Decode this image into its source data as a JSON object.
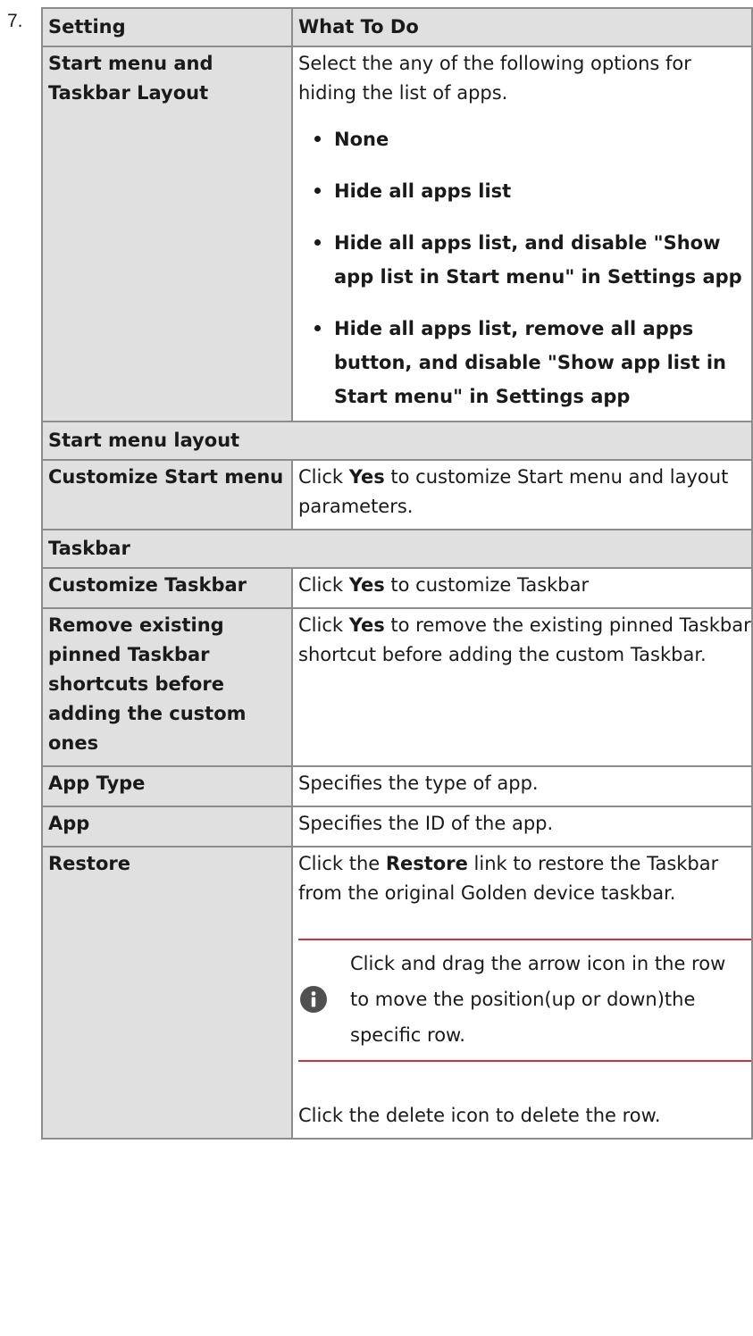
{
  "step_number": "7.",
  "table": {
    "header": {
      "setting": "Setting",
      "todo": "What To Do"
    },
    "rows": [
      {
        "setting": "Start menu and Taskbar Layout",
        "todo_intro": "Select the any of the following options for hiding the list of apps.",
        "options": [
          "None",
          "Hide all apps list",
          "Hide all apps list, and disable \"Show app list in Start menu\" in Settings app",
          "Hide all apps list, remove all apps button, and disable \"Show app list in Start menu\" in Settings app"
        ]
      },
      {
        "section": "Start menu layout"
      },
      {
        "setting": "Customize Start menu",
        "todo_pre": "Click ",
        "todo_bold": "Yes",
        "todo_post": " to customize Start menu and layout parameters."
      },
      {
        "section": "Taskbar"
      },
      {
        "setting": "Customize Taskbar",
        "todo_pre": "Click ",
        "todo_bold": "Yes",
        "todo_post": " to customize Taskbar"
      },
      {
        "setting": "Remove existing pinned Taskbar shortcuts before adding the custom ones",
        "todo_pre": "Click ",
        "todo_bold": "Yes",
        "todo_post": " to remove the existing pinned Taskbar shortcut before adding the custom Taskbar."
      },
      {
        "setting": "App Type",
        "todo": "Specifies the type of app."
      },
      {
        "setting": "App",
        "todo": "Specifies the ID of the app."
      },
      {
        "setting": "Restore",
        "todo_pre": "Click the ",
        "todo_bold": "Restore",
        "todo_post": " link to restore the Taskbar from the original Golden device taskbar.",
        "note": "Click and drag the arrow icon in the row to move the position(up or down)the specific row.",
        "note_icon": "info-icon",
        "after_note": "Click the delete icon to delete the row."
      }
    ]
  },
  "colors": {
    "border": "#8c8c8c",
    "shade": "#e0e0e0",
    "note_rule": "#d12f3b",
    "icon": "#505050"
  }
}
